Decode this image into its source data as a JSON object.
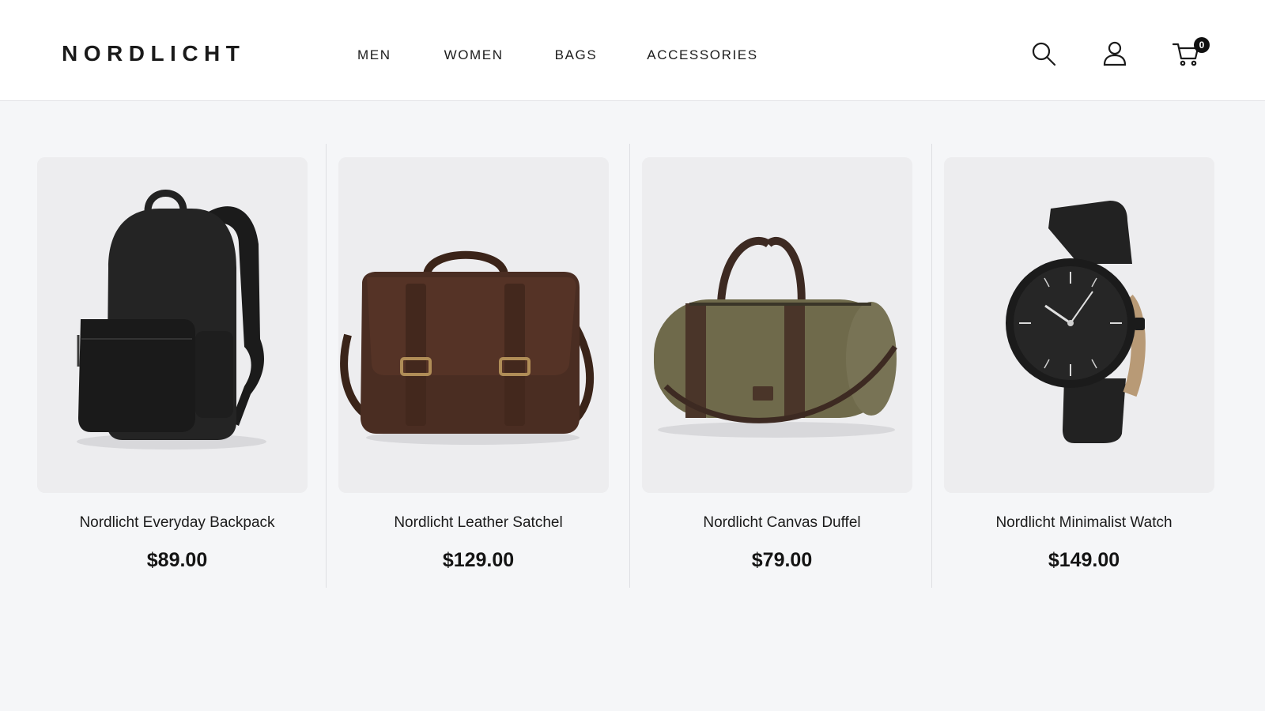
{
  "brand": {
    "name": "NORDLICHT"
  },
  "nav": {
    "items": [
      {
        "label": "MEN"
      },
      {
        "label": "WOMEN"
      },
      {
        "label": "BAGS"
      },
      {
        "label": "ACCESSORIES"
      }
    ]
  },
  "header_icons": {
    "search": "search-icon",
    "account": "user-icon",
    "cart": "cart-icon",
    "cart_count": "0"
  },
  "products": [
    {
      "name": "Nordlicht Everyday Backpack",
      "price": "$89.00",
      "image": "backpack-image",
      "color": "#1f1f1f"
    },
    {
      "name": "Nordlicht Leather Satchel",
      "price": "$129.00",
      "image": "satchel-image",
      "color": "#4a2d22"
    },
    {
      "name": "Nordlicht Canvas Duffel",
      "price": "$79.00",
      "image": "duffel-image",
      "color": "#6f6a4b"
    },
    {
      "name": "Nordlicht Minimalist Watch",
      "price": "$149.00",
      "image": "watch-image",
      "color": "#202020"
    }
  ],
  "colors": {
    "page_bg": "#f5f6f8",
    "header_bg": "#ffffff",
    "text": "#151515",
    "badge": "#111111"
  }
}
